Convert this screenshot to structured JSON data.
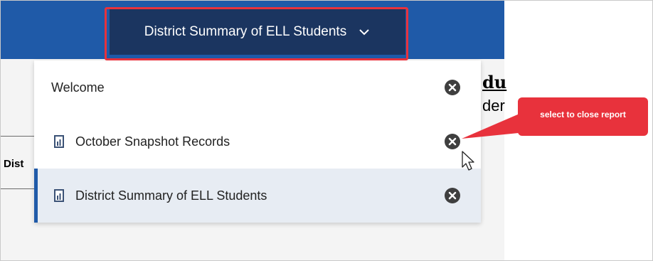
{
  "header": {
    "report_title": "District Summary of ELL Students"
  },
  "background": {
    "fragment_heading": "du",
    "fragment_sub": "der",
    "fragment_col": "Dist"
  },
  "menu": {
    "items": [
      {
        "label": "Welcome",
        "icon": "none",
        "active": false
      },
      {
        "label": "October Snapshot Records",
        "icon": "report-icon",
        "active": false
      },
      {
        "label": "District Summary of ELL Students",
        "icon": "report-icon",
        "active": true
      }
    ]
  },
  "callout": {
    "text": "select to close report"
  },
  "colors": {
    "topbar": "#1f5aa8",
    "button": "#1b3560",
    "highlight": "#e8323c",
    "active_row": "#e7ecf3"
  }
}
